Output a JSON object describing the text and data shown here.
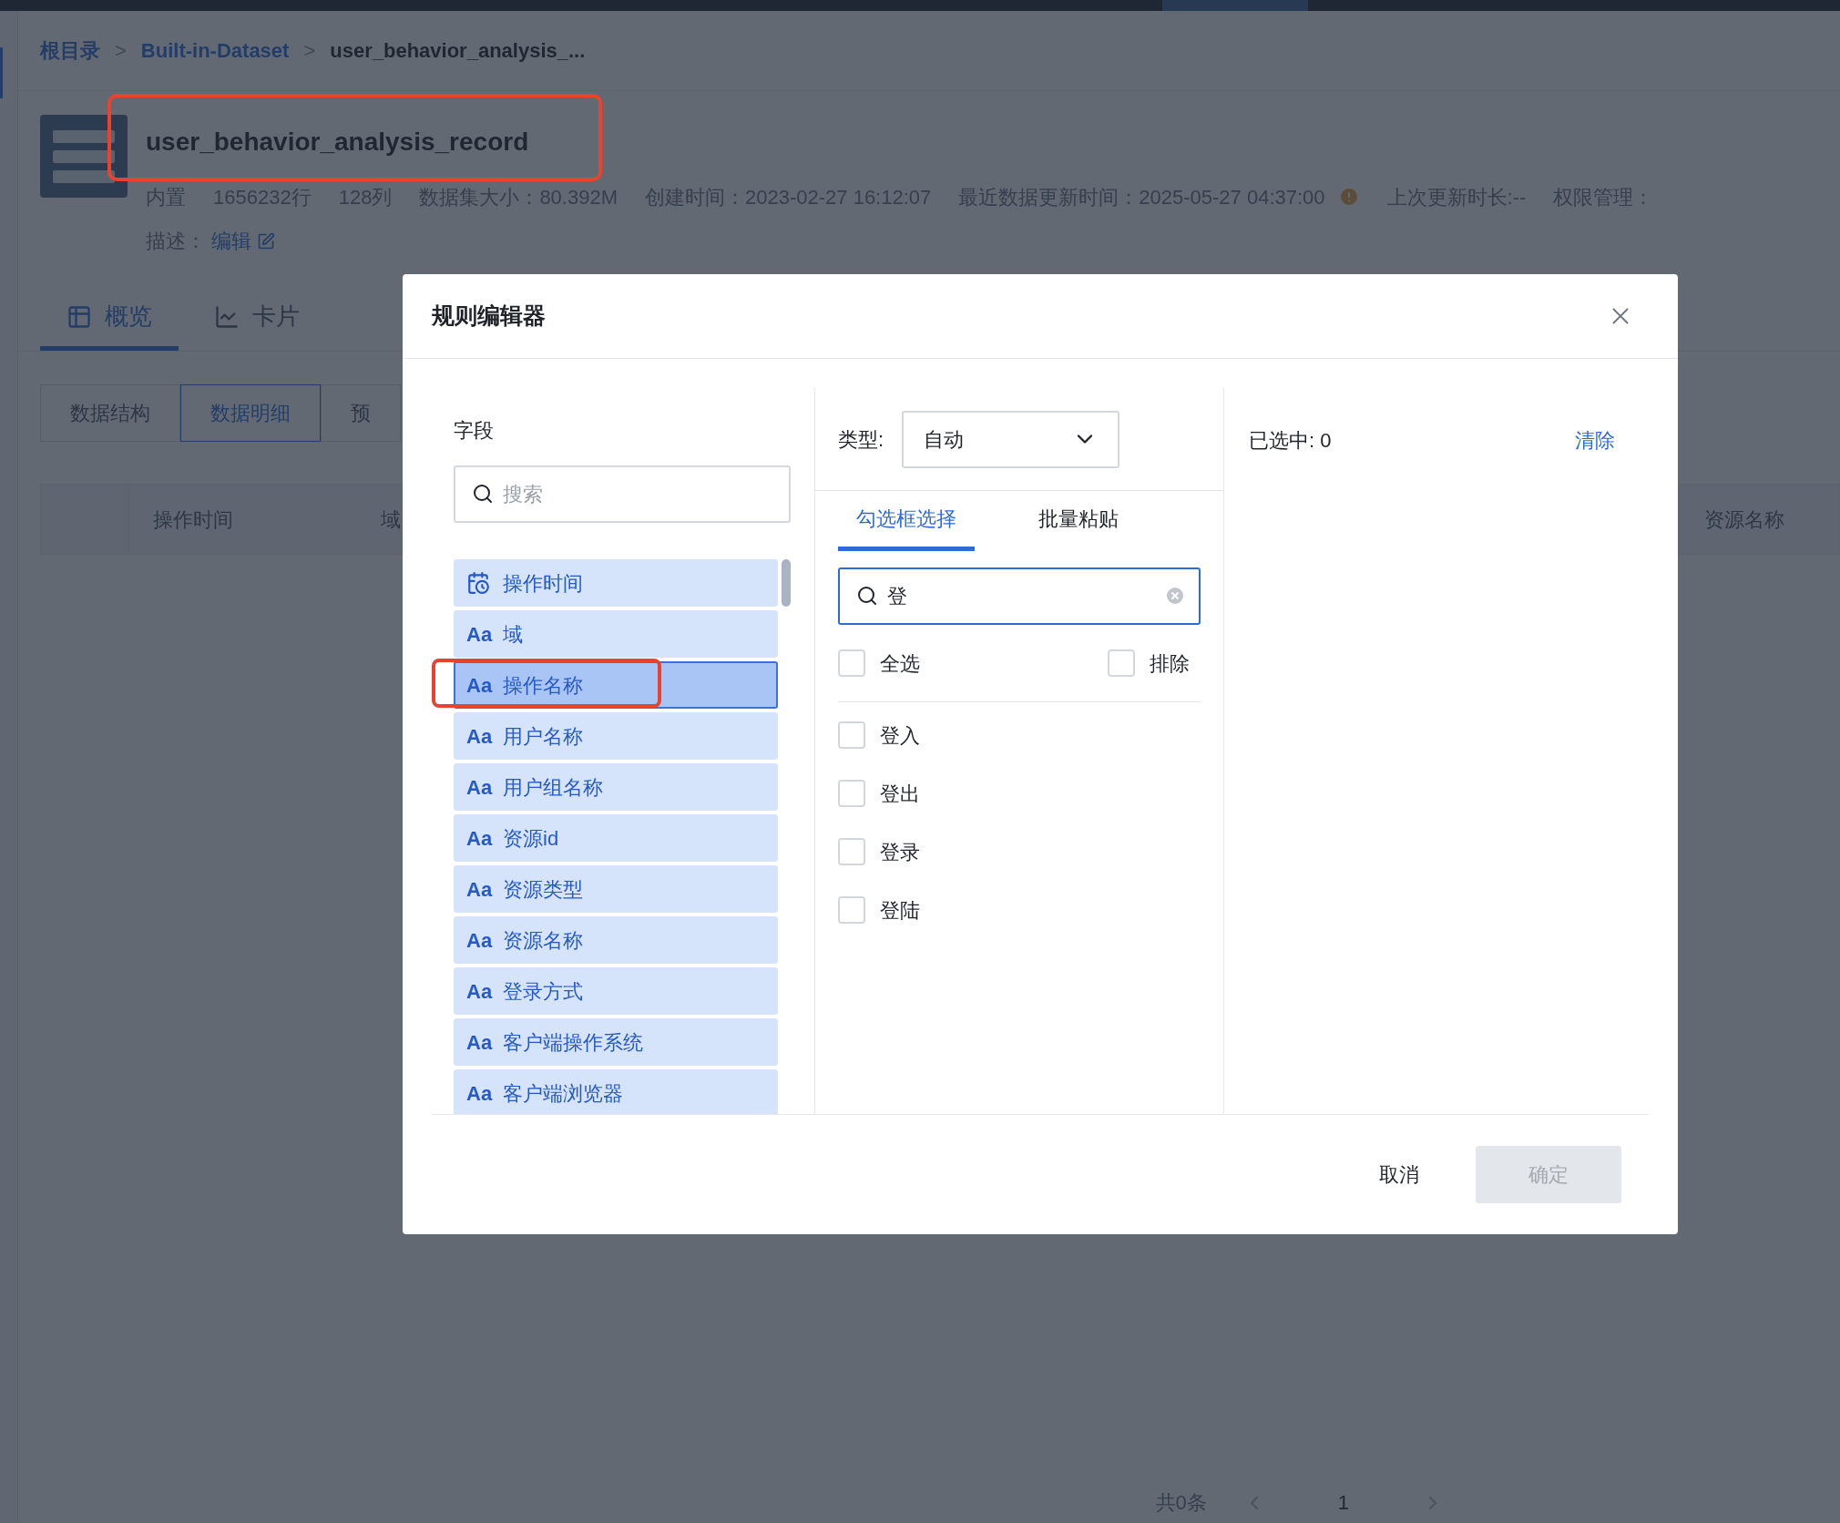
{
  "breadcrumb": [
    {
      "kind": "link",
      "label": "根目录"
    },
    {
      "kind": "separator",
      "label": ">"
    },
    {
      "kind": "link",
      "label": "Built-in-Dataset"
    },
    {
      "kind": "separator",
      "label": ">"
    },
    {
      "kind": "current",
      "label": "user_behavior_analysis_..."
    }
  ],
  "dataset": {
    "title": "user_behavior_analysis_record",
    "highlighted": true,
    "meta": [
      {
        "label": "内置",
        "warning": false
      },
      {
        "label": "1656232行",
        "warning": false
      },
      {
        "label": "128列",
        "warning": false
      },
      {
        "label": "数据集大小：80.392M",
        "warning": false
      },
      {
        "label": "创建时间：2023-02-27 16:12:07",
        "warning": false
      },
      {
        "label": "最近数据更新时间：2025-05-27 04:37:00",
        "warning": true
      },
      {
        "label": "上次更新时长:--",
        "warning": false
      },
      {
        "label": "权限管理：",
        "warning": false
      }
    ],
    "description_label": "描述：",
    "edit_link": "编辑"
  },
  "view_tabs": [
    {
      "label": "概览",
      "selected": true
    },
    {
      "label": "卡片",
      "selected": false
    }
  ],
  "sub_tabs": [
    {
      "label": "数据结构",
      "selected": false
    },
    {
      "label": "数据明细",
      "selected": true
    },
    {
      "label": "预",
      "selected": false
    }
  ],
  "table": {
    "columns": [
      "操作时间",
      "域",
      "资源名称"
    ]
  },
  "pagination": {
    "total": "共0条",
    "page": "1"
  },
  "dialog": {
    "title": "规则编辑器",
    "fields_label": "字段",
    "field_search": {
      "placeholder": "搜索"
    },
    "fields": [
      {
        "kind": "date",
        "name": "操作时间",
        "selected": false,
        "highlighted": false
      },
      {
        "kind": "text",
        "type_label": "Aa",
        "name": "域",
        "selected": false,
        "highlighted": false
      },
      {
        "kind": "text",
        "type_label": "Aa",
        "name": "操作名称",
        "selected": true,
        "highlighted": true
      },
      {
        "kind": "text",
        "type_label": "Aa",
        "name": "用户名称",
        "selected": false,
        "highlighted": false
      },
      {
        "kind": "text",
        "type_label": "Aa",
        "name": "用户组名称",
        "selected": false,
        "highlighted": false
      },
      {
        "kind": "text",
        "type_label": "Aa",
        "name": "资源id",
        "selected": false,
        "highlighted": false
      },
      {
        "kind": "text",
        "type_label": "Aa",
        "name": "资源类型",
        "selected": false,
        "highlighted": false
      },
      {
        "kind": "text",
        "type_label": "Aa",
        "name": "资源名称",
        "selected": false,
        "highlighted": false
      },
      {
        "kind": "text",
        "type_label": "Aa",
        "name": "登录方式",
        "selected": false,
        "highlighted": false
      },
      {
        "kind": "text",
        "type_label": "Aa",
        "name": "客户端操作系统",
        "selected": false,
        "highlighted": false
      },
      {
        "kind": "text",
        "type_label": "Aa",
        "name": "客户端浏览器",
        "selected": false,
        "highlighted": false
      }
    ],
    "type_label": "类型:",
    "type_select": {
      "value": "自动"
    },
    "tabs": [
      {
        "label": "勾选框选择",
        "selected": true
      },
      {
        "label": "批量粘贴",
        "selected": false
      }
    ],
    "value_search": {
      "value": "登"
    },
    "select_all": {
      "label": "全选",
      "checked": false
    },
    "exclude": {
      "label": "排除",
      "checked": false
    },
    "options": [
      {
        "label": "登入",
        "checked": false
      },
      {
        "label": "登出",
        "checked": false
      },
      {
        "label": "登录",
        "checked": false
      },
      {
        "label": "登陆",
        "checked": false
      }
    ],
    "selected_count": "已选中: 0",
    "clear": "清除",
    "buttons": [
      {
        "kind": "secondary",
        "label": "取消",
        "disabled": false
      },
      {
        "kind": "primary",
        "label": "确定",
        "disabled": true
      }
    ]
  }
}
